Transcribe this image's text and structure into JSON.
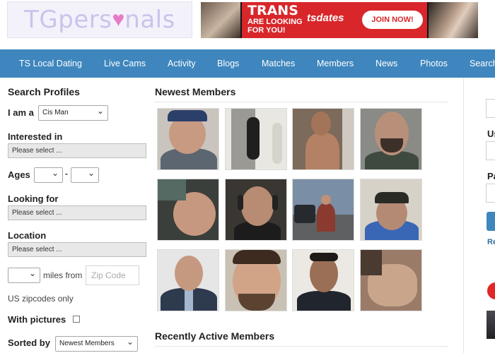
{
  "header": {
    "logo_text_pre": "TGpers",
    "logo_heart": "♥",
    "logo_text_post": "nals",
    "ad": {
      "headline": "TRANS",
      "subline": "ARE LOOKING FOR YOU!",
      "brand": "tsdates",
      "cta": "JOIN NOW!"
    }
  },
  "nav": {
    "items": [
      "TS Local Dating",
      "Live Cams",
      "Activity",
      "Blogs",
      "Matches",
      "Members",
      "News",
      "Photos",
      "Search"
    ]
  },
  "search": {
    "title": "Search Profiles",
    "i_am_label": "I am a",
    "i_am_value": "Cis Man",
    "interested_label": "Interested in",
    "interested_value": "Please select ...",
    "ages_label": "Ages",
    "ages_separator": "-",
    "looking_label": "Looking for",
    "looking_value": "Please select ...",
    "location_label": "Location",
    "location_value": "Please select ...",
    "miles_from_label": "miles from",
    "zip_placeholder": "Zip Code",
    "zip_note": "US zipcodes only",
    "with_pictures_label": "With pictures",
    "sorted_label": "Sorted by",
    "sorted_value": "Newest Members"
  },
  "main": {
    "newest_title": "Newest Members",
    "recent_title": "Recently Active Members"
  },
  "right": {
    "labels": [
      "Us",
      "Pa"
    ],
    "link": "Re"
  },
  "colors": {
    "nav_bg": "#3e86bd",
    "ad_red": "#d8262a",
    "link": "#2f6fa4"
  }
}
